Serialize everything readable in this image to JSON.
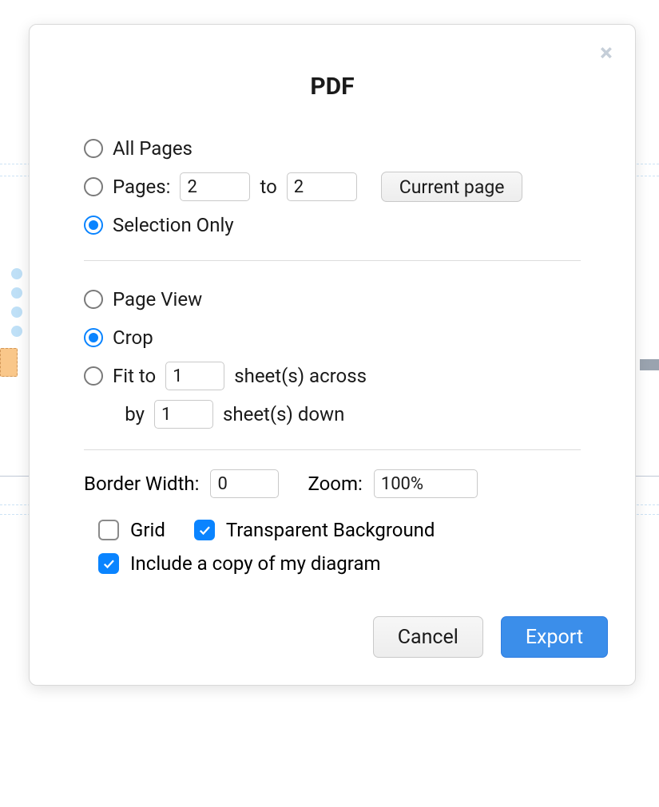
{
  "dialog": {
    "title": "PDF",
    "scope": {
      "allPages": {
        "label": "All Pages",
        "checked": false
      },
      "pages": {
        "label": "Pages:",
        "from": "2",
        "toLabel": "to",
        "to": "2",
        "currentPageBtn": "Current page",
        "checked": false
      },
      "selectionOnly": {
        "label": "Selection Only",
        "checked": true
      }
    },
    "layout": {
      "pageView": {
        "label": "Page View",
        "checked": false
      },
      "crop": {
        "label": "Crop",
        "checked": true
      },
      "fit": {
        "checked": false,
        "labelPrefix": "Fit to",
        "across": "1",
        "acrossSuffix": "sheet(s) across",
        "byLabel": "by",
        "down": "1",
        "downSuffix": "sheet(s) down"
      }
    },
    "options": {
      "borderWidthLabel": "Border Width:",
      "borderWidth": "0",
      "zoomLabel": "Zoom:",
      "zoom": "100%",
      "grid": {
        "label": "Grid",
        "checked": false
      },
      "transparent": {
        "label": "Transparent Background",
        "checked": true
      },
      "includeCopy": {
        "label": "Include a copy of my diagram",
        "checked": true
      }
    },
    "footer": {
      "cancel": "Cancel",
      "export": "Export"
    }
  }
}
